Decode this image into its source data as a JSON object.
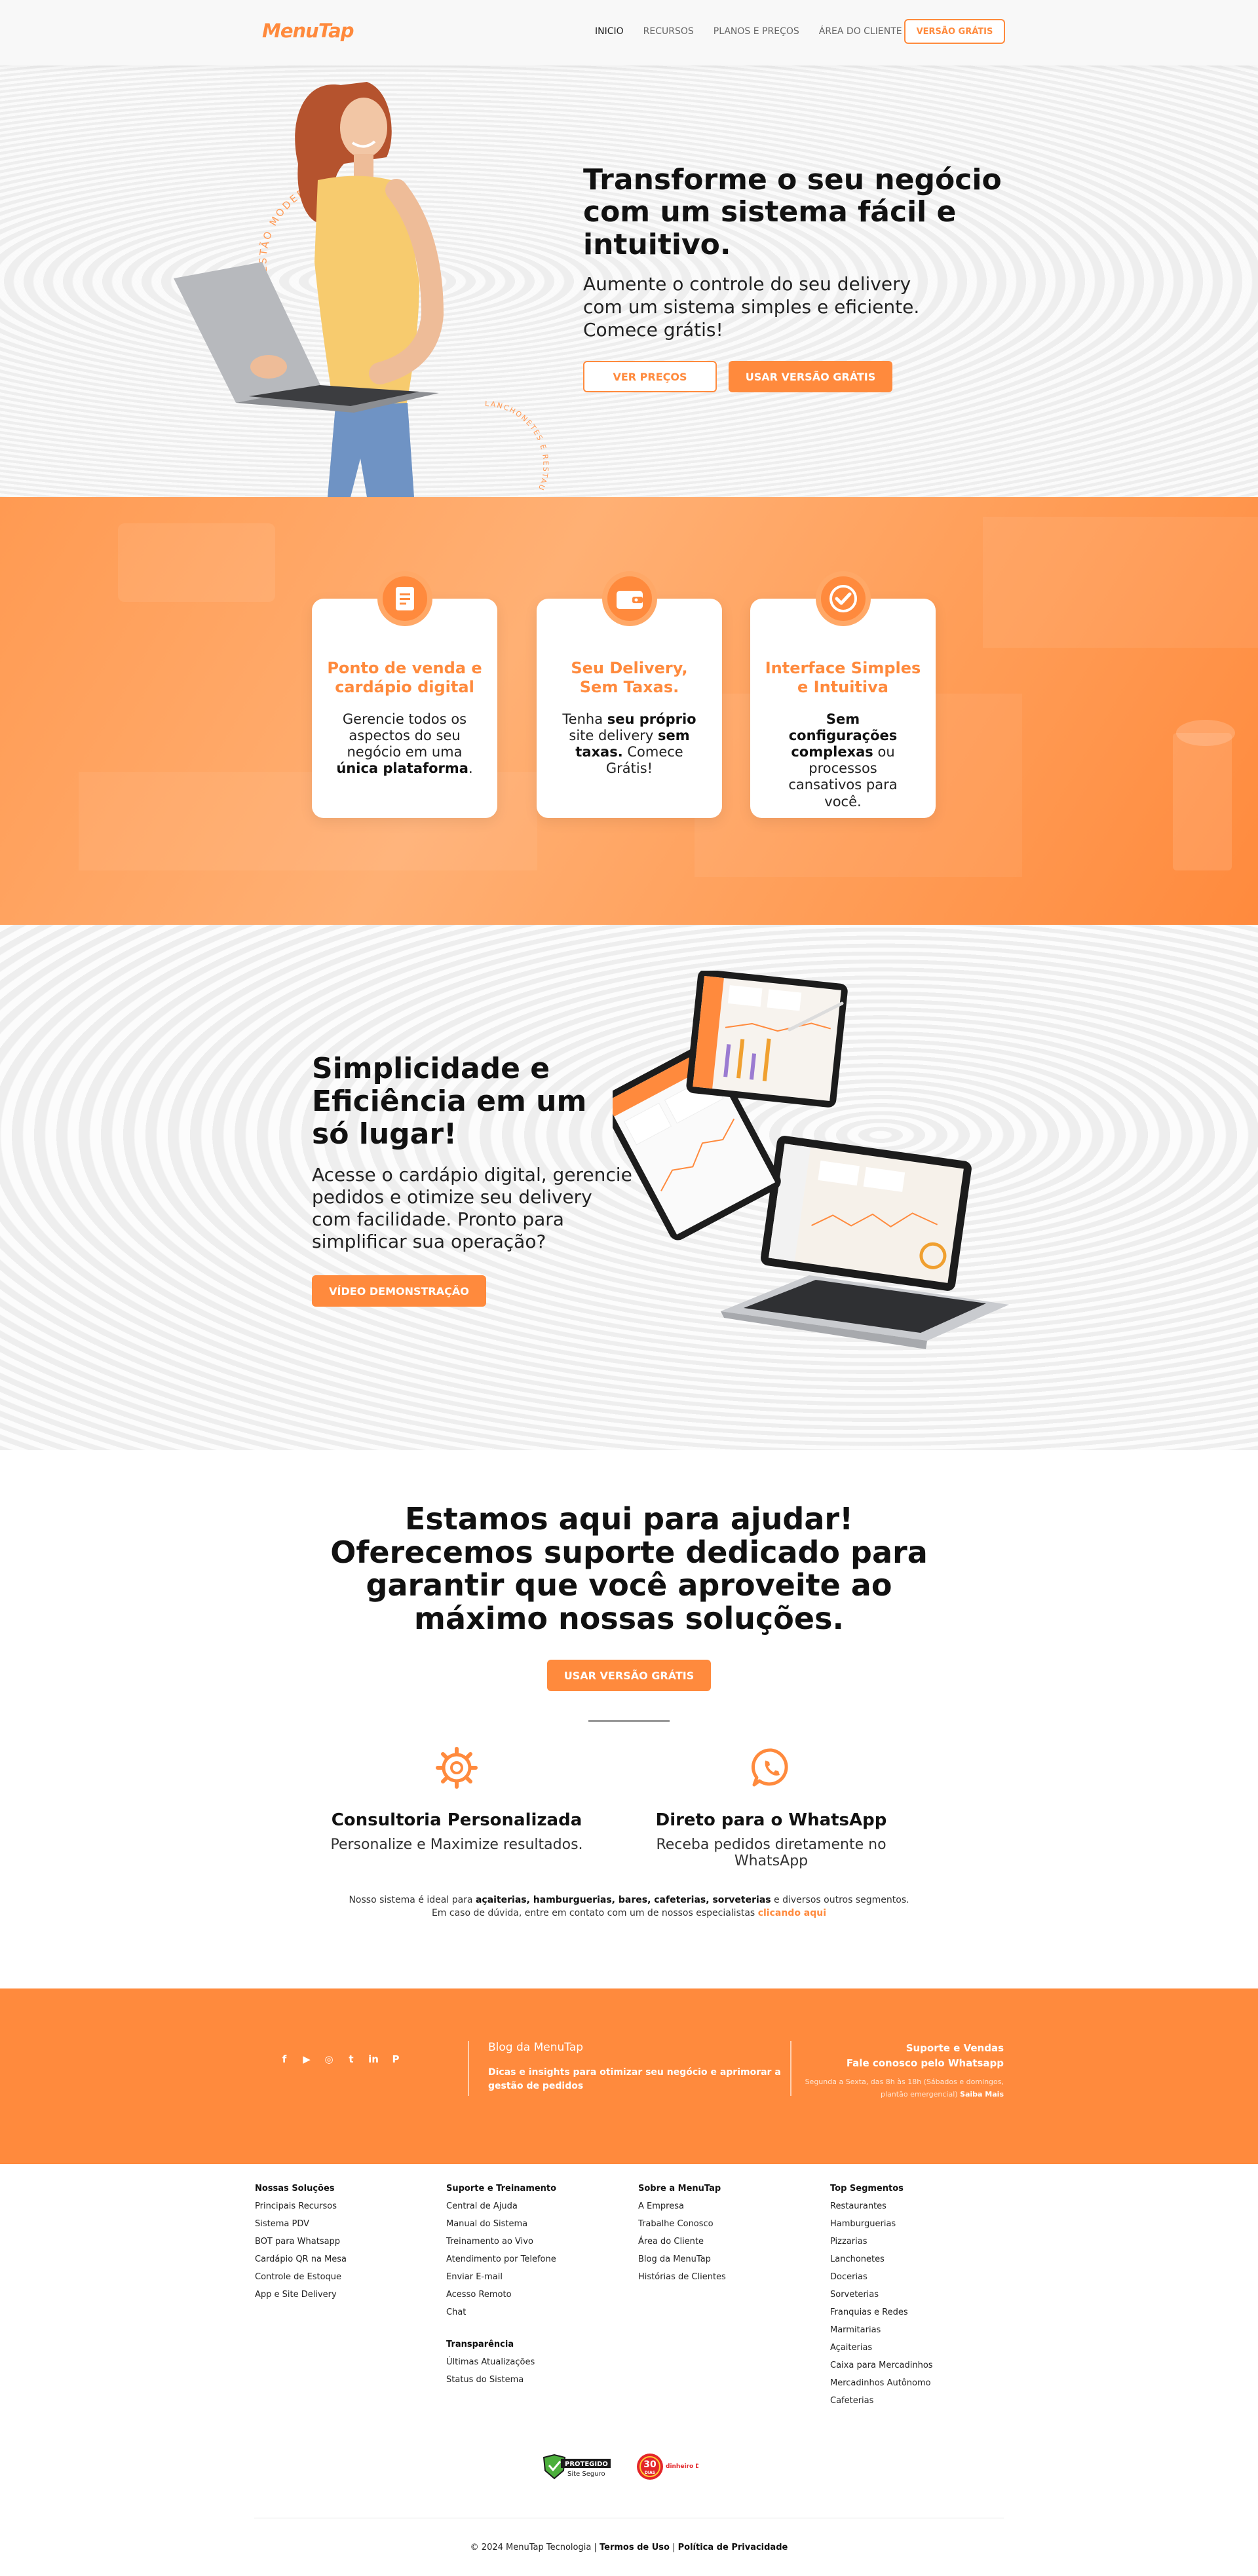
{
  "header": {
    "logo": "MenuTap",
    "nav": [
      "INICIO",
      "RECURSOS",
      "PLANOS E PREÇOS",
      "ÁREA DO CLIENTE"
    ],
    "cta": "VERSÃO GRÁTIS"
  },
  "hero": {
    "title": "Transforme o seu negócio com um sistema fácil e intuitivo.",
    "subtitle": "Aumente o controle do seu delivery com um sistema simples e eficiente. Comece grátis!",
    "btn_prices": "VER PREÇOS",
    "btn_free": "USAR VERSÃO GRÁTIS",
    "circle_text_1": "GESTÃO MODERNA PARA LANCHONETES",
    "circle_text_2": "LANCHONETES E RESTAURANTES"
  },
  "features": [
    {
      "icon": "document-icon",
      "title": "Ponto de venda e cardápio digital",
      "text_pre": "Gerencie todos os aspectos do seu negócio em uma ",
      "text_bold": "única plataforma",
      "text_post": "."
    },
    {
      "icon": "wallet-icon",
      "title": "Seu Delivery, Sem Taxas.",
      "text_pre": "Tenha ",
      "text_bold": "seu próprio",
      "text_mid": " site delivery ",
      "text_bold2": "sem taxas.",
      "text_post": " Comece Grátis!"
    },
    {
      "icon": "check-circle-icon",
      "title": "Interface Simples e Intuitiva",
      "text_bold": "Sem configurações complexas",
      "text_post": " ou processos cansativos para você."
    }
  ],
  "simplicity": {
    "title": "Simplicidade e Eficiência em um só lugar!",
    "text": "Acesse o cardápio digital, gerencie pedidos e otimize seu delivery com facilidade. Pronto para simplificar sua operação?",
    "btn": "VÍDEO DEMONSTRAÇÃO"
  },
  "support": {
    "title": "Estamos aqui para ajudar! Oferecemos suporte dedicado para garantir que você aproveite ao máximo nossas soluções.",
    "btn": "USAR VERSÃO GRÁTIS",
    "col1_title": "Consultoria Personalizada",
    "col1_sub": "Personalize e Maximize resultados.",
    "col2_title": "Direto para o WhatsApp",
    "col2_sub": "Receba pedidos diretamente no WhatsApp",
    "note_pre": "Nosso sistema é ideal para ",
    "note_bold": "açaiterias, hamburguerias, bares, cafeterias, sorveterias",
    "note_post": " e diversos outros segmentos.",
    "note2_pre": "Em caso de dúvida, entre em contato com um de nossos especialistas ",
    "note2_link": "clicando aqui"
  },
  "footer_orange": {
    "social_icons": [
      "facebook-icon",
      "youtube-icon",
      "instagram-icon",
      "twitter-icon",
      "linkedin-icon",
      "pinterest-icon"
    ],
    "blog_heading": "Blog da MenuTap",
    "blog_text": "Dicas e insights para otimizar seu negócio e aprimorar a gestão de pedidos",
    "contact_title": "Suporte e Vendas",
    "contact_sub": "Fale conosco pelo Whatsapp",
    "hours": "Segunda a Sexta, das 8h às 18h (Sábados e domingos, plantão emergencial)",
    "more": "Saiba Mais"
  },
  "footer_links": {
    "col1": {
      "heading": "Nossas Soluções",
      "items": [
        "Principais Recursos",
        "Sistema PDV",
        "BOT para Whatsapp",
        "Cardápio QR na Mesa",
        "Controle de Estoque",
        "App e Site Delivery"
      ]
    },
    "col2": {
      "heading": "Suporte e Treinamento",
      "items": [
        "Central de Ajuda",
        "Manual do Sistema",
        "Treinamento ao Vivo",
        "Atendimento por Telefone",
        "Enviar E-mail",
        "Acesso Remoto",
        "Chat"
      ],
      "heading2": "Transparência",
      "items2": [
        "Últimas Atualizações",
        "Status do Sistema"
      ]
    },
    "col3": {
      "heading": "Sobre a MenuTap",
      "items": [
        "A Empresa",
        "Trabalhe Conosco",
        "Área do Cliente",
        "Blog da MenuTap",
        "Histórias de Clientes"
      ]
    },
    "col4": {
      "heading": "Top Segmentos",
      "items": [
        "Restaurantes",
        "Hamburguerias",
        "Pizzarias",
        "Lanchonetes",
        "Docerias",
        "Sorveterias",
        "Franquias e Redes",
        "Marmitarias",
        "Açaiterias",
        "Caixa para Mercadinhos",
        "Mercadinhos Autônomo",
        "Cafeterias"
      ]
    },
    "badge1_top": "PROTEGIDO",
    "badge1_bottom": "Site Seguro",
    "badge2_num": "30",
    "badge2_text": "DIAS",
    "badge2_label": "dinheiro DE VOLTA",
    "copyright": "© 2024 MenuTap Tecnologia |",
    "terms": "Termos de Uso",
    "sep": " | ",
    "privacy": "Política de Privacidade"
  },
  "colors": {
    "accent": "#ff8a3d",
    "dark": "#111111"
  }
}
